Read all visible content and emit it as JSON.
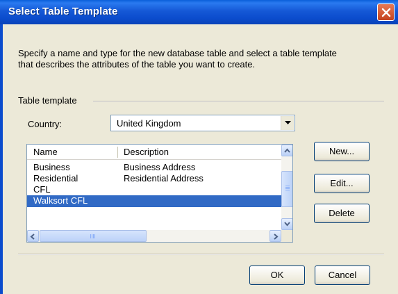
{
  "window": {
    "title": "Select Table Template"
  },
  "instructions": {
    "line1": "Specify a name and type for the new database table and select a table template",
    "line2": "that describes the attributes of the table you want to create."
  },
  "group": {
    "label": "Table template"
  },
  "country": {
    "label": "Country:",
    "value": "United Kingdom"
  },
  "list": {
    "columns": [
      "Name",
      "Description"
    ],
    "rows": [
      {
        "name": "Business",
        "description": "Business Address",
        "selected": false
      },
      {
        "name": "Residential",
        "description": "Residential Address",
        "selected": false
      },
      {
        "name": "CFL",
        "description": "",
        "selected": false
      },
      {
        "name": "Walksort CFL",
        "description": "",
        "selected": true
      }
    ]
  },
  "side_buttons": {
    "new": "New...",
    "edit": "Edit...",
    "delete": "Delete"
  },
  "footer": {
    "ok": "OK",
    "cancel": "Cancel"
  },
  "colors": {
    "titlebar": "#0b4ccd",
    "selection": "#316ac5",
    "dialog": "#ece9d8",
    "close": "#d65a33"
  },
  "icons": [
    "close-icon",
    "dropdown-arrow-icon",
    "scroll-up-icon",
    "scroll-down-icon",
    "scroll-left-icon",
    "scroll-right-icon"
  ]
}
